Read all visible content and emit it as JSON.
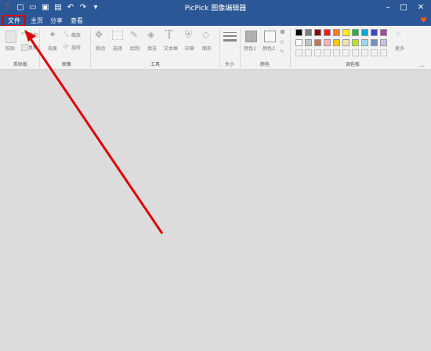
{
  "app": {
    "title": "PicPick 图像编辑器"
  },
  "quick_access": [
    "app-logo",
    "new-icon",
    "open-icon",
    "save-icon",
    "print-icon",
    "undo-icon",
    "redo-icon",
    "customize-icon"
  ],
  "window_controls": {
    "minimize": "–",
    "maximize": "□",
    "close": "✕"
  },
  "tabs": [
    {
      "label": "文件",
      "active": false
    },
    {
      "label": "主页",
      "active": true
    },
    {
      "label": "分享",
      "active": false
    },
    {
      "label": "查看",
      "active": false
    }
  ],
  "ribbon": {
    "clipboard": {
      "paste": "粘贴",
      "cut": "剪切",
      "copy": "复制",
      "group": "剪贴板"
    },
    "image": {
      "effects": "效果",
      "resize": "缩放",
      "rotate": "旋转",
      "group": "图像"
    },
    "tools": {
      "move": "移动",
      "select": "选择",
      "draw": "绘制",
      "fill": "填充",
      "text": "文本框",
      "stamp": "印章",
      "shape": "图形",
      "group": "工具"
    },
    "size": {
      "group": "大小"
    },
    "color": {
      "color1": "颜色1",
      "color2": "颜色2",
      "group": "颜色"
    },
    "palette": {
      "more": "更多",
      "group": "调色板"
    },
    "palette_colors": [
      "#000000",
      "#7f7f7f",
      "#880015",
      "#ed1c24",
      "#ff7f27",
      "#fff200",
      "#22b14c",
      "#00a2e8",
      "#3f48cc",
      "#a349a4"
    ],
    "palette_colors2": [
      "#ffffff",
      "#c3c3c3",
      "#b97a57",
      "#ffaec9",
      "#ffc90e",
      "#efe4b0",
      "#b5e61d",
      "#99d9ea",
      "#7092be",
      "#c8bfe7"
    ]
  },
  "accent": "#2b5797",
  "highlight": "#e10000"
}
